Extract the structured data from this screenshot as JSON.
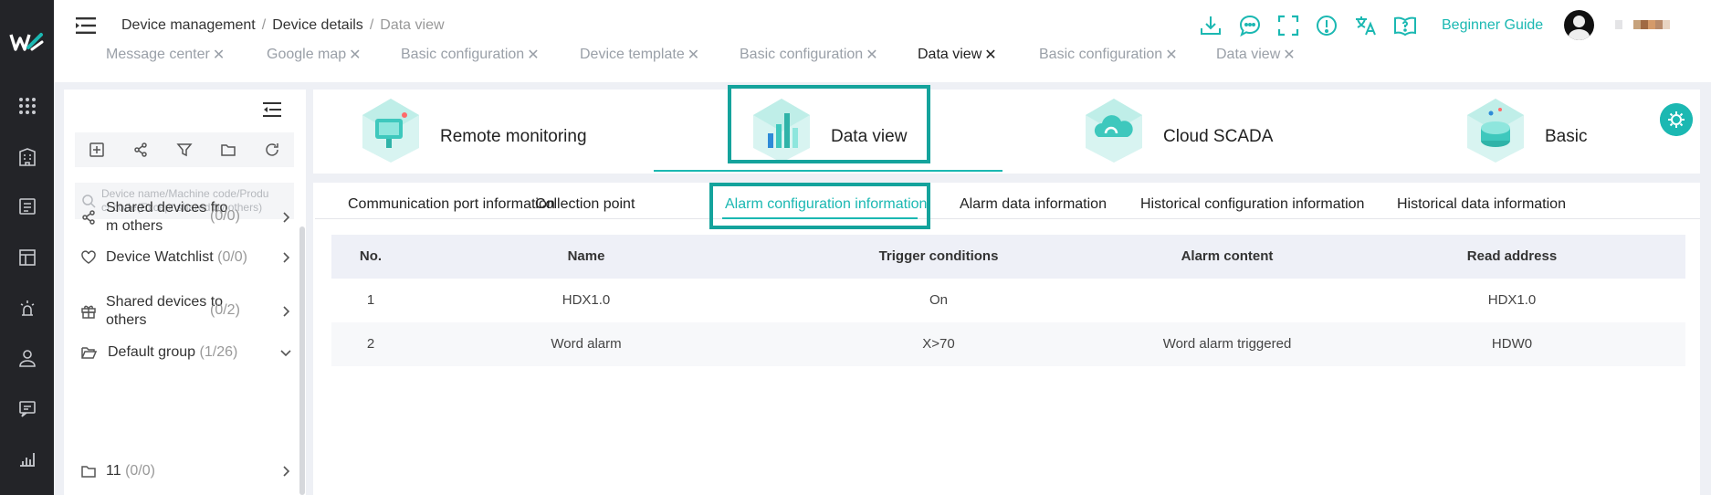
{
  "colors": {
    "accent": "#1bb8b2",
    "highlight_box": "#14a39c",
    "rail": "#232428"
  },
  "rail": {
    "logo": "logo-mark",
    "icons": [
      "grid-icon",
      "building-icon",
      "list-card-icon",
      "layout-icon",
      "alarm-icon",
      "user-icon",
      "message-icon",
      "bar-chart-icon"
    ]
  },
  "header": {
    "breadcrumb": [
      "Device management",
      "Device details",
      "Data view"
    ],
    "icons": [
      "download-icon",
      "chat-icon",
      "fullscreen-icon",
      "info-icon",
      "translate-icon",
      "help-book-icon"
    ],
    "guide_label": "Beginner Guide",
    "page_tabs": [
      {
        "label": "Message center",
        "active": false
      },
      {
        "label": "Google map",
        "active": false
      },
      {
        "label": "Basic configuration",
        "active": false
      },
      {
        "label": "Device template",
        "active": false
      },
      {
        "label": "Basic configuration",
        "active": false
      },
      {
        "label": "Data view",
        "active": true
      },
      {
        "label": "Basic configuration",
        "active": false
      },
      {
        "label": "Data view",
        "active": false
      }
    ]
  },
  "left_panel": {
    "toolbar_icons": [
      "add-icon",
      "share-icon",
      "filter-icon",
      "folder-icon",
      "refresh-icon"
    ],
    "search_placeholder": "Device name/Machine code/Product code(Except shared by others)",
    "search_line1": "Device name/Machine code/Produ",
    "search_line2": "ct code(Except shared by others)",
    "items": [
      {
        "line1": "Shared devices fro",
        "line2": "m others",
        "count": "(0/0)",
        "icon": "share-icon",
        "chevron": "chevron-right-icon"
      },
      {
        "line1": "Device Watchlist",
        "line2": "",
        "count": "(0/0)",
        "icon": "heart-icon",
        "chevron": "chevron-right-icon"
      },
      {
        "line1": "Shared devices to",
        "line2": "others",
        "count": "(0/2)",
        "icon": "gift-icon",
        "chevron": "chevron-right-icon"
      },
      {
        "line1": "Default group",
        "line2": "",
        "count": "(1/26)",
        "icon": "folder-open-icon",
        "chevron": "chevron-down-icon"
      },
      {
        "line1": "11",
        "line2": "",
        "count": "(0/0)",
        "icon": "folder-icon",
        "chevron": "chevron-right-icon"
      }
    ]
  },
  "view_tabs": [
    {
      "label": "Remote monitoring",
      "active": false
    },
    {
      "label": "Data view",
      "active": true
    },
    {
      "label": "Cloud SCADA",
      "active": false
    },
    {
      "label": "Basic",
      "active": false
    }
  ],
  "sub_tabs": [
    {
      "label": "Communication port information",
      "active": false
    },
    {
      "label": "Collection point",
      "active": false
    },
    {
      "label": "Alarm configuration information",
      "active": true
    },
    {
      "label": "Alarm data information",
      "active": false
    },
    {
      "label": "Historical configuration information",
      "active": false
    },
    {
      "label": "Historical data information",
      "active": false
    }
  ],
  "table": {
    "headers": [
      "No.",
      "Name",
      "Trigger conditions",
      "Alarm content",
      "Read address"
    ],
    "rows": [
      [
        "1",
        "HDX1.0",
        "On",
        "",
        "HDX1.0"
      ],
      [
        "2",
        "Word alarm",
        "X>70",
        "Word alarm triggered",
        "HDW0"
      ]
    ]
  }
}
